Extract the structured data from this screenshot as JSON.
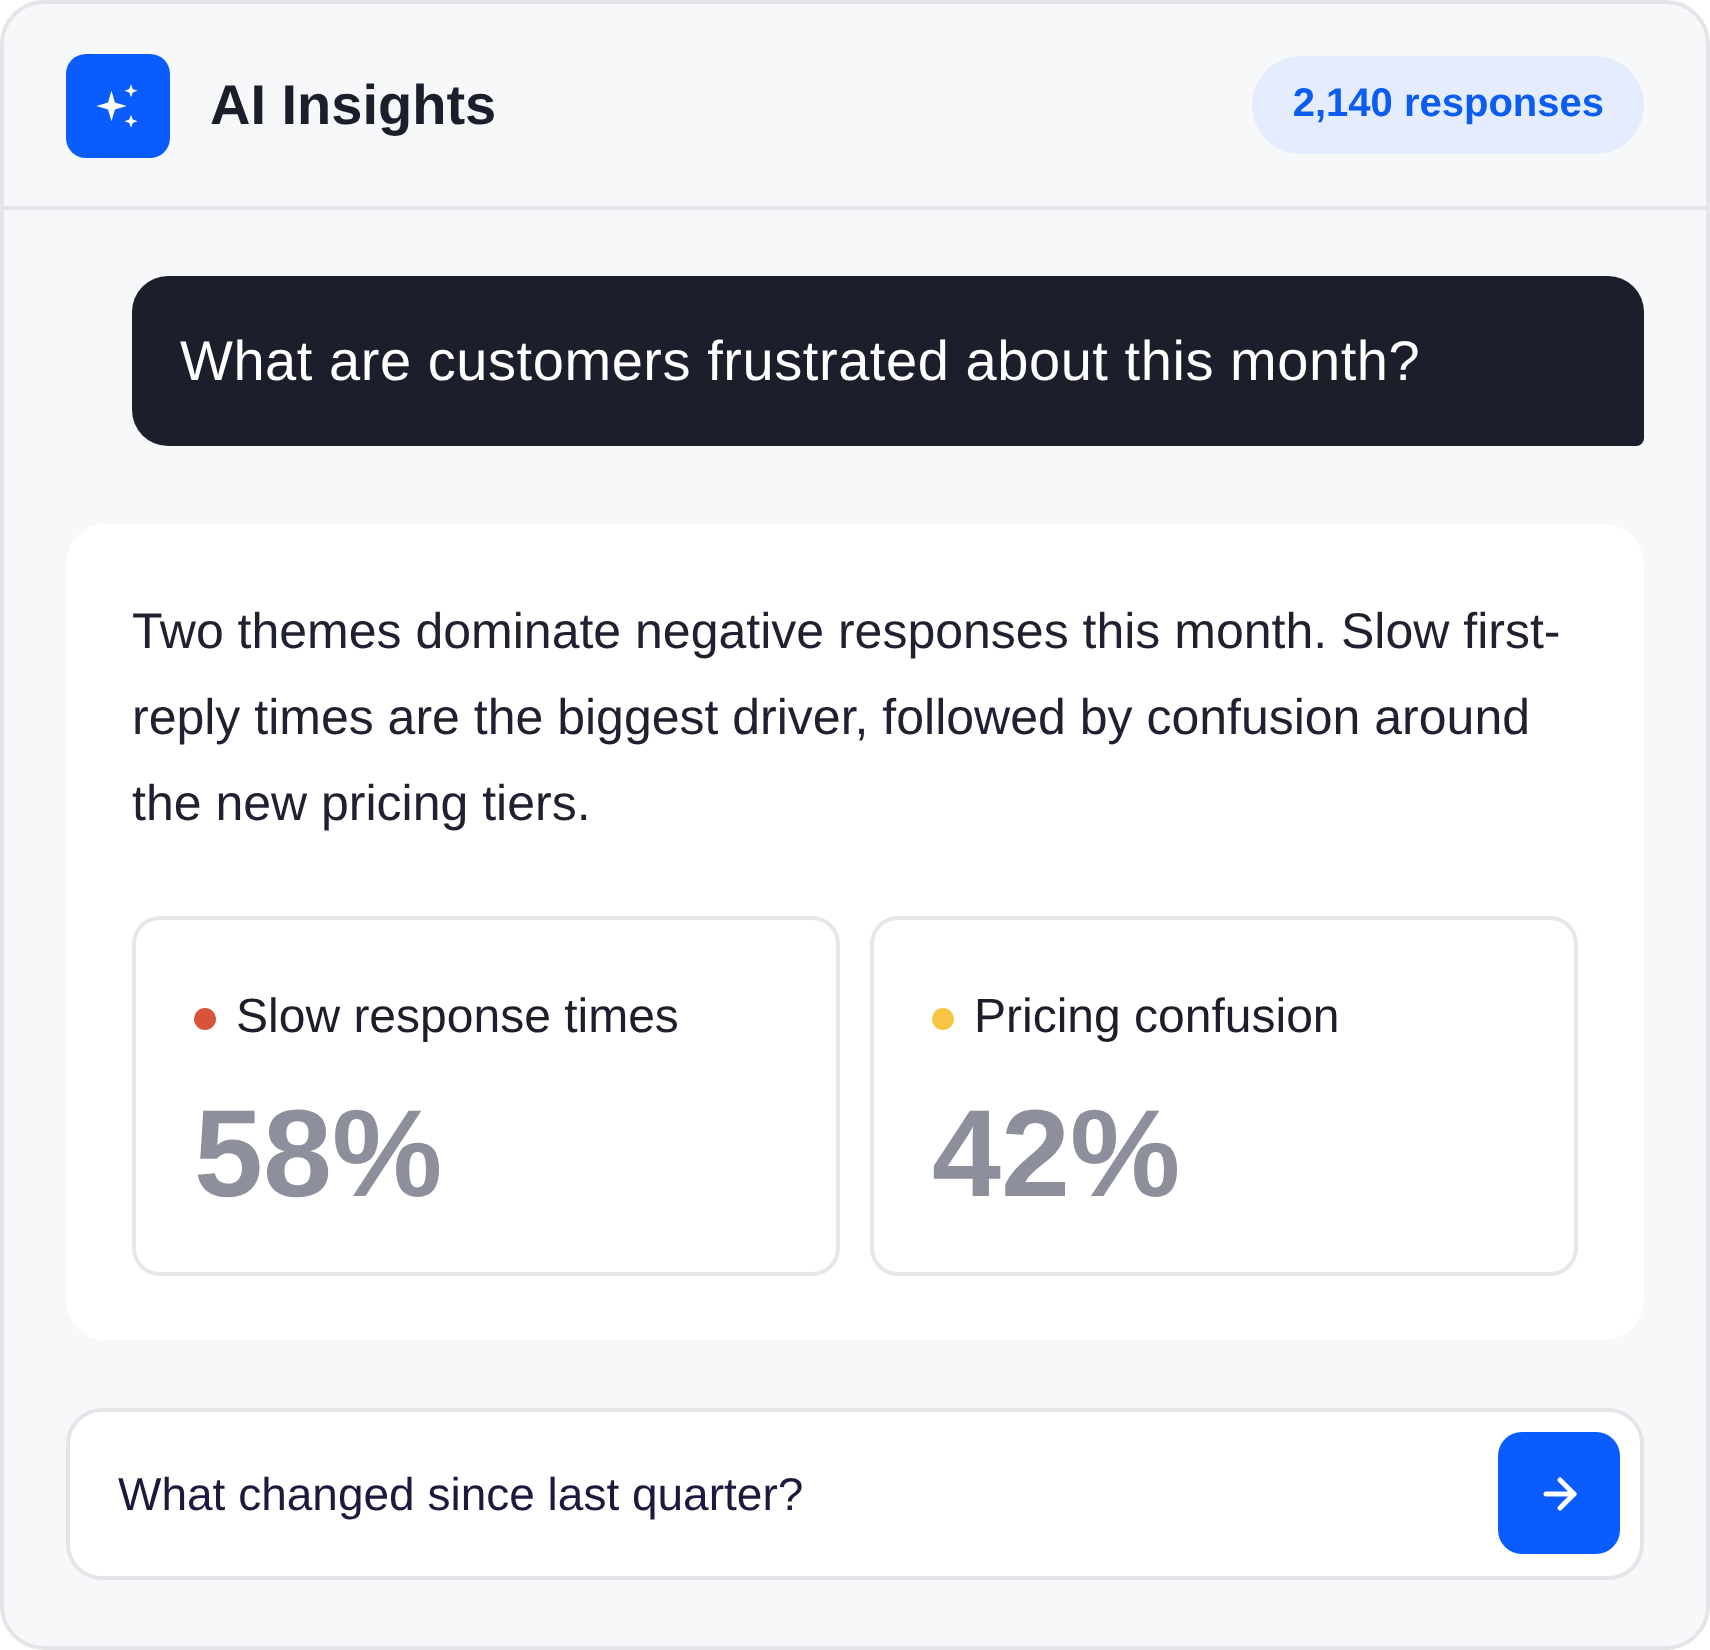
{
  "header": {
    "title": "AI Insights",
    "badge": "2,140 responses"
  },
  "messages": [
    {
      "kind": "user",
      "text": "What are customers frustrated about this month?"
    },
    {
      "kind": "answer",
      "text": "Two themes dominate negative responses this month. Slow first-reply times are the biggest driver, followed by confusion around the new pricing tiers.",
      "stats": [
        {
          "label": "Slow response times",
          "value": "58%",
          "color": "#d9533a"
        },
        {
          "label": "Pricing confusion",
          "value": "42%",
          "color": "#f7c543"
        }
      ]
    }
  ],
  "composer": {
    "value": "What changed since last quarter?"
  }
}
